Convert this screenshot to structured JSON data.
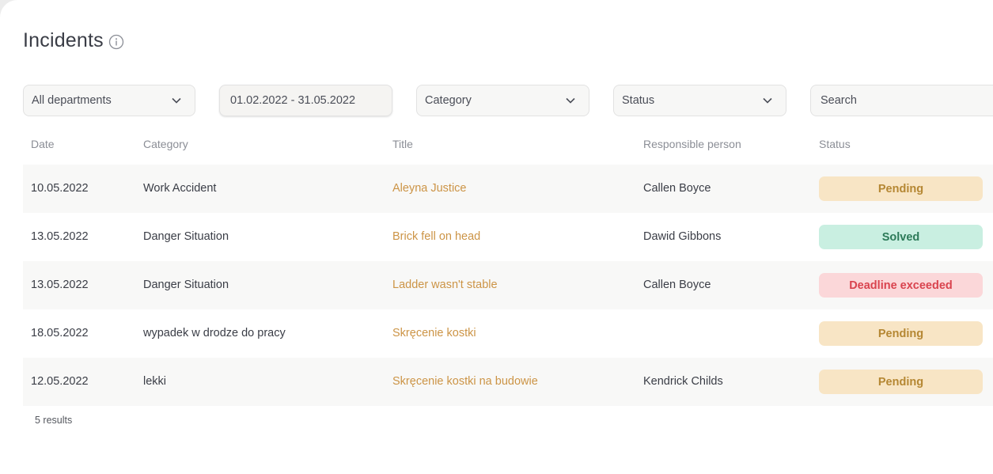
{
  "page": {
    "title": "Incidents"
  },
  "filters": {
    "department": "All departments",
    "date_range": "01.02.2022 - 31.05.2022",
    "category": "Category",
    "status": "Status",
    "search_placeholder": "Search"
  },
  "table": {
    "headers": {
      "date": "Date",
      "category": "Category",
      "title": "Title",
      "responsible": "Responsible person",
      "status": "Status"
    },
    "rows": [
      {
        "date": "10.05.2022",
        "category": "Work Accident",
        "title": "Aleyna Justice",
        "responsible": "Callen Boyce",
        "status": "Pending"
      },
      {
        "date": "13.05.2022",
        "category": "Danger Situation",
        "title": "Brick fell on head",
        "responsible": "Dawid Gibbons",
        "status": "Solved"
      },
      {
        "date": "13.05.2022",
        "category": "Danger Situation",
        "title": "Ladder wasn't stable",
        "responsible": "Callen Boyce",
        "status": "Deadline exceeded"
      },
      {
        "date": "18.05.2022",
        "category": "wypadek w drodze do pracy",
        "title": "Skręcenie kostki",
        "responsible": "",
        "status": "Pending"
      },
      {
        "date": "12.05.2022",
        "category": "lekki",
        "title": "Skręcenie kostki na budowie",
        "responsible": "Kendrick Childs",
        "status": "Pending"
      }
    ]
  },
  "results_text": "5 results",
  "colors": {
    "accent_link": "#cc9446",
    "pending_bg": "#f8e5c5",
    "solved_bg": "#c9efe1",
    "exceeded_bg": "#fbd7d9"
  }
}
